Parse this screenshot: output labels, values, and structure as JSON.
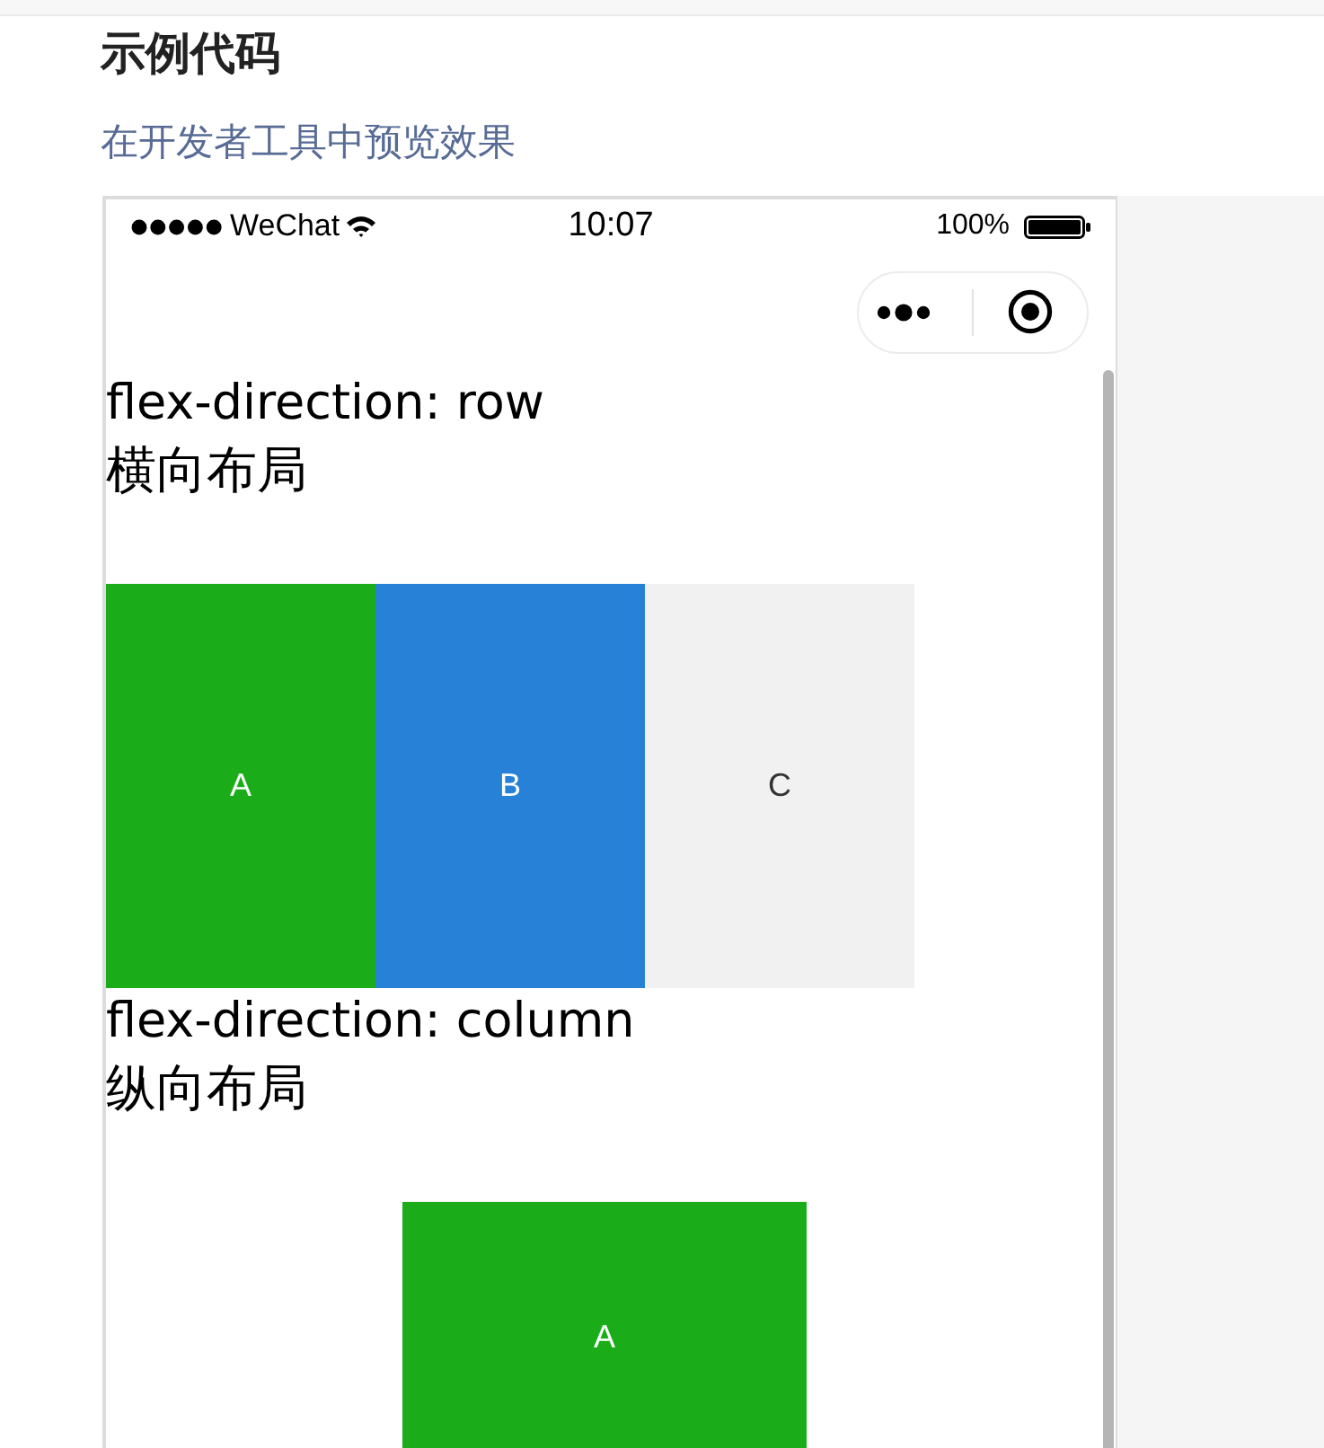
{
  "header": {
    "title": "示例代码",
    "link": "在开发者工具中预览效果"
  },
  "phone": {
    "status_bar": {
      "carrier": "WeChat",
      "time": "10:07",
      "battery": "100%"
    },
    "sections": [
      {
        "title": "flex-direction: row",
        "subtitle": "横向布局",
        "vertical": false,
        "items": [
          {
            "label": "A",
            "color": "#1aad19"
          },
          {
            "label": "B",
            "color": "#2782d7"
          },
          {
            "label": "C",
            "color": "#f1f1f1"
          }
        ]
      },
      {
        "title": "flex-direction: column",
        "subtitle": "纵向布局",
        "vertical": true,
        "items": [
          {
            "label": "A",
            "color": "#1aad19"
          }
        ]
      }
    ]
  }
}
